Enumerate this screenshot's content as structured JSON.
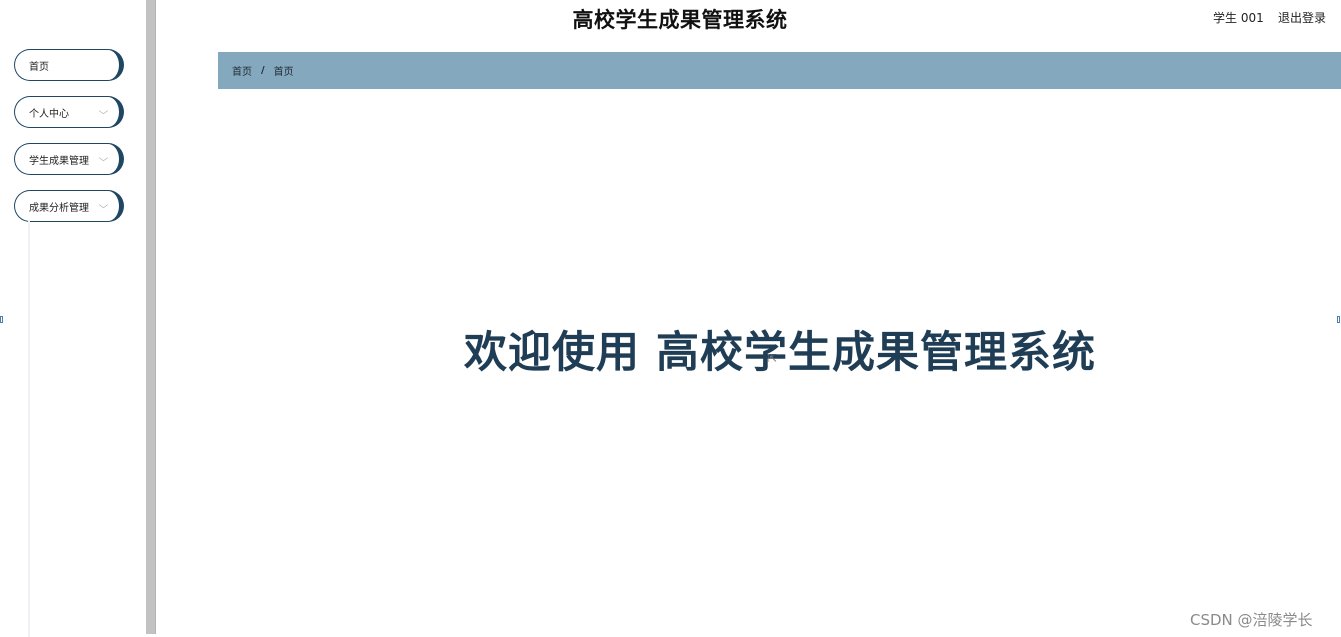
{
  "header": {
    "title": "高校学生成果管理系统",
    "user": "学生 001",
    "logout": "退出登录"
  },
  "sidebar": {
    "items": [
      {
        "label": "首页",
        "has_submenu": false,
        "icon": ""
      },
      {
        "label": "个人中心",
        "has_submenu": true,
        "icon": "chevron-down-icon"
      },
      {
        "label": "学生成果管理",
        "has_submenu": true,
        "icon": "chevron-down-icon"
      },
      {
        "label": "成果分析管理",
        "has_submenu": true,
        "icon": "chevron-down-icon"
      }
    ]
  },
  "breadcrumb": {
    "home": "首页",
    "separator": "/",
    "current": "首页"
  },
  "main": {
    "welcome": "欢迎使用 高校学生成果管理系统"
  },
  "watermark": "CSDN @涪陵学长",
  "colors": {
    "accent": "#1f4663",
    "breadcrumb_bg": "#84a8be",
    "welcome_text": "#1f3d55"
  }
}
